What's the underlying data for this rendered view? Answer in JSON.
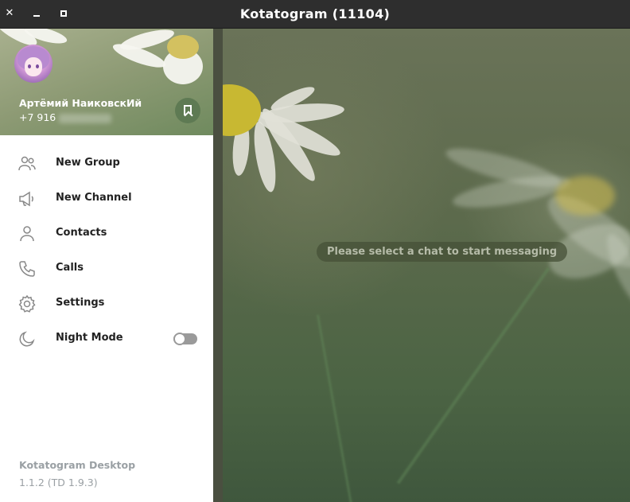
{
  "window": {
    "title": "Kotatogram (11104)",
    "controls": [
      "close-icon",
      "minimize-icon",
      "maximize-icon"
    ]
  },
  "profile": {
    "name": "Артёмий НаиковскИй",
    "phone_prefix": "+7 916",
    "saved_icon": "bookmark-icon"
  },
  "menu": {
    "items": [
      {
        "label": "New Group",
        "icon": "group-icon"
      },
      {
        "label": "New Channel",
        "icon": "megaphone-icon"
      },
      {
        "label": "Contacts",
        "icon": "person-icon"
      },
      {
        "label": "Calls",
        "icon": "phone-icon"
      },
      {
        "label": "Settings",
        "icon": "gear-icon"
      },
      {
        "label": "Night Mode",
        "icon": "moon-icon",
        "toggle": false
      }
    ]
  },
  "footer": {
    "app_name": "Kotatogram Desktop",
    "version": "1.1.2 (TD 1.9.3)"
  },
  "chat": {
    "empty_message": "Please select a chat to start messaging"
  },
  "colors": {
    "menu_bg": "#ffffff",
    "titlebar_bg": "#2e2e2e",
    "accent_green": "#5e7a53",
    "footer_text": "#9aa0a4"
  }
}
